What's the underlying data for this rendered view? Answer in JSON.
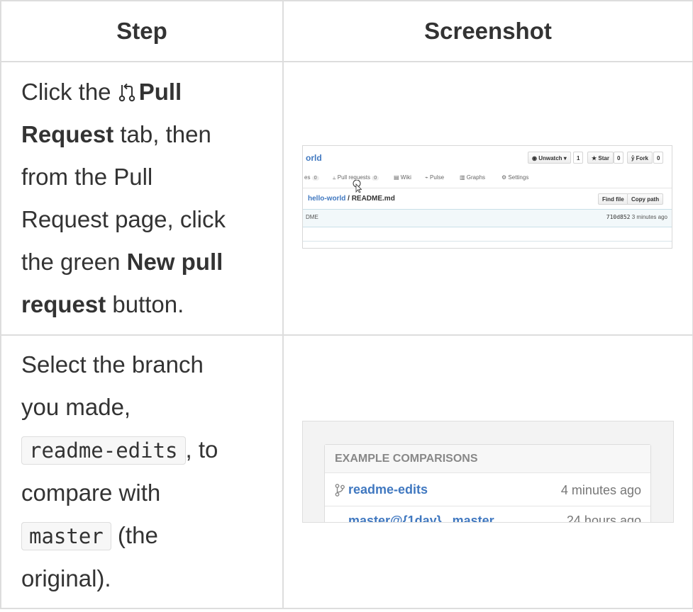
{
  "table": {
    "headers": [
      "Step",
      "Screenshot"
    ]
  },
  "step1": {
    "t1": "Click the ",
    "b1": "Pull",
    "b2": "Request",
    "t2": " tab, then",
    "t3": "from the Pull",
    "t4": "Request page, click",
    "t5": "the green ",
    "b3": "New pull",
    "b4": "request",
    "t6": " button.",
    "icon": "pull-request-icon"
  },
  "step2": {
    "t1": "Select the branch",
    "t2": "you made,",
    "code1": "readme-edits",
    "t3": ", to",
    "t4": "compare with",
    "code2": "master",
    "t5": " (the",
    "t6": "original)."
  },
  "screenshot1": {
    "repo_name": "orld",
    "unwatch": "Unwatch ▾",
    "unwatch_count": "1",
    "star": "Star",
    "star_count": "0",
    "fork": "Fork",
    "fork_count": "0",
    "tabs": {
      "issues": "es",
      "issues_count": "0",
      "pull_requests": "Pull requests",
      "pull_requests_count": "0",
      "wiki": "Wiki",
      "pulse": "Pulse",
      "graphs": "Graphs",
      "settings": "Settings"
    },
    "breadcrumb_repo": "hello-world",
    "breadcrumb_sep": " / ",
    "breadcrumb_file": "README.md",
    "find_file": "Find file",
    "copy_path": "Copy path",
    "commit_msg": "DME",
    "commit_hash": "710d852",
    "commit_time": "3 minutes ago"
  },
  "screenshot2": {
    "header": "EXAMPLE COMPARISONS",
    "branch_name": "readme-edits",
    "branch_time": "4 minutes ago",
    "row2_name": "master@{1day}...master",
    "row2_time": "24 hours ago"
  },
  "colors": {
    "link": "#4078c0",
    "border": "#dddddd",
    "text": "#333333",
    "muted": "#777777"
  }
}
